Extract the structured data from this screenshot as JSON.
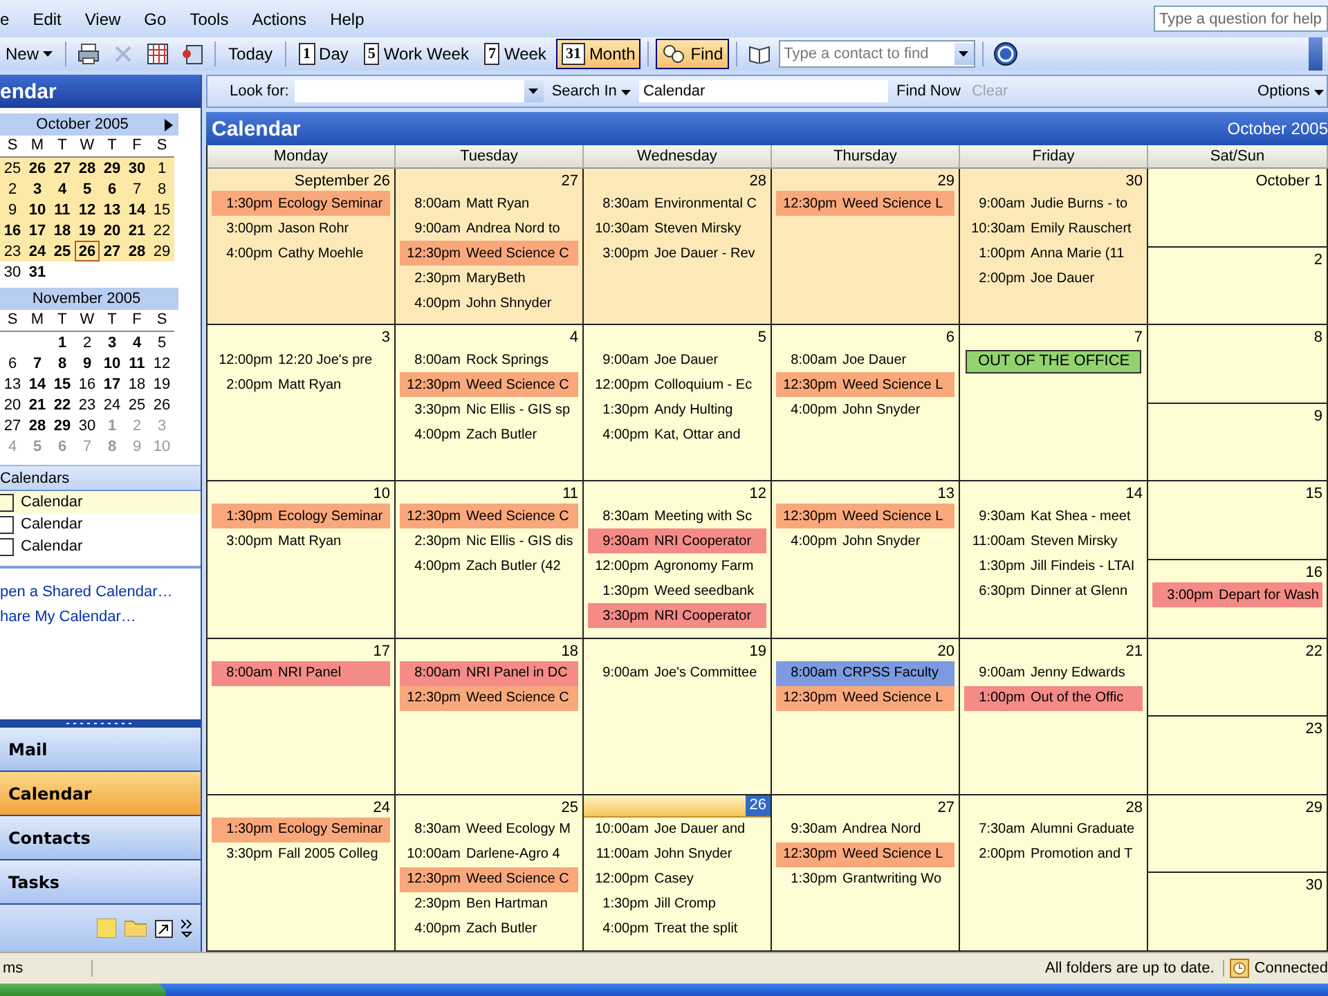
{
  "menu": [
    {
      "label": "e"
    },
    {
      "label": "Edit"
    },
    {
      "label": "View"
    },
    {
      "label": "Go"
    },
    {
      "label": "Tools"
    },
    {
      "label": "Actions"
    },
    {
      "label": "Help"
    }
  ],
  "help_box": {
    "placeholder": "Type a question for help"
  },
  "toolbar": [
    {
      "kind": "button",
      "label": "New",
      "dropdown": true,
      "selected": false
    },
    {
      "kind": "sep"
    },
    {
      "kind": "print",
      "disabled": false
    },
    {
      "kind": "delete",
      "disabled": true
    },
    {
      "kind": "grid",
      "disabled": false
    },
    {
      "kind": "address",
      "disabled": false
    },
    {
      "kind": "sep"
    },
    {
      "kind": "button",
      "label": "Today",
      "selected": false
    },
    {
      "kind": "sep"
    },
    {
      "kind": "button",
      "label": "Day",
      "badge": "1",
      "selected": false
    },
    {
      "kind": "button",
      "label": "Work Week",
      "badge": "5",
      "selected": false
    },
    {
      "kind": "button",
      "label": "Week",
      "badge": "7",
      "selected": false
    },
    {
      "kind": "button",
      "label": "Month",
      "badge": "31",
      "selected": true
    },
    {
      "kind": "sep"
    },
    {
      "kind": "find",
      "label": "Find",
      "selected": true
    },
    {
      "kind": "sep"
    },
    {
      "kind": "book",
      "disabled": false
    },
    {
      "kind": "field",
      "placeholder": "Type a contact to find"
    },
    {
      "kind": "sep"
    },
    {
      "kind": "help",
      "disabled": false
    }
  ],
  "pane_title": "endar",
  "mini_calendars": [
    {
      "title": "October 2005",
      "weekdays": [
        "S",
        "M",
        "T",
        "W",
        "T",
        "F",
        "S"
      ],
      "weeks": [
        {
          "in_view": true,
          "days": [
            {
              "day": "25",
              "bold": false,
              "dim": false,
              "selected": false
            },
            {
              "day": "26",
              "bold": true,
              "dim": false,
              "selected": false
            },
            {
              "day": "27",
              "bold": true,
              "dim": false,
              "selected": false
            },
            {
              "day": "28",
              "bold": true,
              "dim": false,
              "selected": false
            },
            {
              "day": "29",
              "bold": true,
              "dim": false,
              "selected": false
            },
            {
              "day": "30",
              "bold": true,
              "dim": false,
              "selected": false
            },
            {
              "day": "1",
              "bold": false,
              "dim": false,
              "selected": false
            }
          ]
        },
        {
          "in_view": true,
          "days": [
            {
              "day": "2",
              "bold": false,
              "dim": false,
              "selected": false
            },
            {
              "day": "3",
              "bold": true,
              "dim": false,
              "selected": false
            },
            {
              "day": "4",
              "bold": true,
              "dim": false,
              "selected": false
            },
            {
              "day": "5",
              "bold": true,
              "dim": false,
              "selected": false
            },
            {
              "day": "6",
              "bold": true,
              "dim": false,
              "selected": false
            },
            {
              "day": "7",
              "bold": false,
              "dim": false,
              "selected": false
            },
            {
              "day": "8",
              "bold": false,
              "dim": false,
              "selected": false
            }
          ]
        },
        {
          "in_view": true,
          "days": [
            {
              "day": "9",
              "bold": false,
              "dim": false,
              "selected": false
            },
            {
              "day": "10",
              "bold": true,
              "dim": false,
              "selected": false
            },
            {
              "day": "11",
              "bold": true,
              "dim": false,
              "selected": false
            },
            {
              "day": "12",
              "bold": true,
              "dim": false,
              "selected": false
            },
            {
              "day": "13",
              "bold": true,
              "dim": false,
              "selected": false
            },
            {
              "day": "14",
              "bold": true,
              "dim": false,
              "selected": false
            },
            {
              "day": "15",
              "bold": false,
              "dim": false,
              "selected": false
            }
          ]
        },
        {
          "in_view": true,
          "days": [
            {
              "day": "16",
              "bold": true,
              "dim": false,
              "selected": false
            },
            {
              "day": "17",
              "bold": true,
              "dim": false,
              "selected": false
            },
            {
              "day": "18",
              "bold": true,
              "dim": false,
              "selected": false
            },
            {
              "day": "19",
              "bold": true,
              "dim": false,
              "selected": false
            },
            {
              "day": "20",
              "bold": true,
              "dim": false,
              "selected": false
            },
            {
              "day": "21",
              "bold": true,
              "dim": false,
              "selected": false
            },
            {
              "day": "22",
              "bold": false,
              "dim": false,
              "selected": false
            }
          ]
        },
        {
          "in_view": true,
          "days": [
            {
              "day": "23",
              "bold": false,
              "dim": false,
              "selected": false
            },
            {
              "day": "24",
              "bold": true,
              "dim": false,
              "selected": false
            },
            {
              "day": "25",
              "bold": true,
              "dim": false,
              "selected": false
            },
            {
              "day": "26",
              "bold": true,
              "dim": false,
              "selected": true
            },
            {
              "day": "27",
              "bold": true,
              "dim": false,
              "selected": false
            },
            {
              "day": "28",
              "bold": true,
              "dim": false,
              "selected": false
            },
            {
              "day": "29",
              "bold": false,
              "dim": false,
              "selected": false
            }
          ]
        },
        {
          "in_view": false,
          "days": [
            {
              "day": "30",
              "bold": false,
              "dim": false,
              "selected": false
            },
            {
              "day": "31",
              "bold": true,
              "dim": false,
              "selected": false
            }
          ]
        }
      ]
    },
    {
      "title": "November 2005",
      "weekdays": [
        "S",
        "M",
        "T",
        "W",
        "T",
        "F",
        "S"
      ],
      "weeks": [
        {
          "in_view": false,
          "days": [
            {
              "day": "1",
              "bold": true,
              "dim": false,
              "selected": false
            },
            {
              "day": "2",
              "bold": false,
              "dim": false,
              "selected": false
            },
            {
              "day": "3",
              "bold": true,
              "dim": false,
              "selected": false
            },
            {
              "day": "4",
              "bold": true,
              "dim": false,
              "selected": false
            },
            {
              "day": "5",
              "bold": false,
              "dim": false,
              "selected": false
            }
          ]
        },
        {
          "in_view": false,
          "days": [
            {
              "day": "6",
              "bold": false,
              "dim": false,
              "selected": false
            },
            {
              "day": "7",
              "bold": true,
              "dim": false,
              "selected": false
            },
            {
              "day": "8",
              "bold": true,
              "dim": false,
              "selected": false
            },
            {
              "day": "9",
              "bold": true,
              "dim": false,
              "selected": false
            },
            {
              "day": "10",
              "bold": true,
              "dim": false,
              "selected": false
            },
            {
              "day": "11",
              "bold": true,
              "dim": false,
              "selected": false
            },
            {
              "day": "12",
              "bold": false,
              "dim": false,
              "selected": false
            }
          ]
        },
        {
          "in_view": false,
          "days": [
            {
              "day": "13",
              "bold": false,
              "dim": false,
              "selected": false
            },
            {
              "day": "14",
              "bold": true,
              "dim": false,
              "selected": false
            },
            {
              "day": "15",
              "bold": true,
              "dim": false,
              "selected": false
            },
            {
              "day": "16",
              "bold": false,
              "dim": false,
              "selected": false
            },
            {
              "day": "17",
              "bold": true,
              "dim": false,
              "selected": false
            },
            {
              "day": "18",
              "bold": false,
              "dim": false,
              "selected": false
            },
            {
              "day": "19",
              "bold": false,
              "dim": false,
              "selected": false
            }
          ]
        },
        {
          "in_view": false,
          "days": [
            {
              "day": "20",
              "bold": false,
              "dim": false,
              "selected": false
            },
            {
              "day": "21",
              "bold": true,
              "dim": false,
              "selected": false
            },
            {
              "day": "22",
              "bold": true,
              "dim": false,
              "selected": false
            },
            {
              "day": "23",
              "bold": false,
              "dim": false,
              "selected": false
            },
            {
              "day": "24",
              "bold": false,
              "dim": false,
              "selected": false
            },
            {
              "day": "25",
              "bold": false,
              "dim": false,
              "selected": false
            },
            {
              "day": "26",
              "bold": false,
              "dim": false,
              "selected": false
            }
          ]
        },
        {
          "in_view": false,
          "days": [
            {
              "day": "27",
              "bold": false,
              "dim": false,
              "selected": false
            },
            {
              "day": "28",
              "bold": true,
              "dim": false,
              "selected": false
            },
            {
              "day": "29",
              "bold": true,
              "dim": false,
              "selected": false
            },
            {
              "day": "30",
              "bold": false,
              "dim": false,
              "selected": false
            },
            {
              "day": "1",
              "bold": true,
              "dim": true,
              "selected": false
            },
            {
              "day": "2",
              "bold": false,
              "dim": true,
              "selected": false
            },
            {
              "day": "3",
              "bold": false,
              "dim": true,
              "selected": false
            }
          ]
        },
        {
          "in_view": false,
          "days": [
            {
              "day": "4",
              "bold": false,
              "dim": true,
              "selected": false
            },
            {
              "day": "5",
              "bold": true,
              "dim": true,
              "selected": false
            },
            {
              "day": "6",
              "bold": true,
              "dim": true,
              "selected": false
            },
            {
              "day": "7",
              "bold": false,
              "dim": true,
              "selected": false
            },
            {
              "day": "8",
              "bold": true,
              "dim": true,
              "selected": false
            },
            {
              "day": "9",
              "bold": false,
              "dim": true,
              "selected": false
            },
            {
              "day": "10",
              "bold": false,
              "dim": true,
              "selected": false
            }
          ]
        }
      ]
    }
  ],
  "calendars": {
    "title": "Calendars",
    "items": [
      {
        "label": "Calendar",
        "checked": false,
        "selected": true
      },
      {
        "label": "Calendar",
        "checked": false,
        "selected": false
      },
      {
        "label": "Calendar",
        "checked": false,
        "selected": false
      }
    ]
  },
  "links": [
    "pen a Shared Calendar…",
    "hare My Calendar…"
  ],
  "nav": [
    {
      "label": "Mail",
      "selected": false
    },
    {
      "label": "Calendar",
      "selected": true
    },
    {
      "label": "Contacts",
      "selected": false
    },
    {
      "label": "Tasks",
      "selected": false
    }
  ],
  "find_bar": {
    "look_for": "Look for:",
    "search_in": "Search In",
    "scope": "Calendar",
    "find_now": "Find Now",
    "clear": "Clear",
    "clear_disabled": true,
    "options": "Options"
  },
  "header": {
    "title": "Calendar",
    "month": "October 2005"
  },
  "columns": [
    "Monday",
    "Tuesday",
    "Wednesday",
    "Thursday",
    "Friday",
    "Sat/Sun"
  ],
  "weeks": [
    {
      "days": [
        {
          "date": "September 26",
          "other_month": true,
          "today": false,
          "events": [
            {
              "kind": "timed",
              "time": "1:30pm",
              "title": "Ecology Seminar",
              "color": "#f9a87c"
            },
            {
              "kind": "timed",
              "time": "3:00pm",
              "title": "Jason Rohr"
            },
            {
              "kind": "timed",
              "time": "4:00pm",
              "title": "Cathy Moehle"
            }
          ]
        },
        {
          "date": "27",
          "other_month": true,
          "today": false,
          "events": [
            {
              "kind": "timed",
              "time": "8:00am",
              "title": "Matt Ryan"
            },
            {
              "kind": "timed",
              "time": "9:00am",
              "title": "Andrea Nord to"
            },
            {
              "kind": "timed",
              "time": "12:30pm",
              "title": "Weed Science C",
              "color": "#f9a87c"
            },
            {
              "kind": "timed",
              "time": "2:30pm",
              "title": "MaryBeth"
            },
            {
              "kind": "timed",
              "time": "4:00pm",
              "title": "John Shnyder"
            }
          ]
        },
        {
          "date": "28",
          "other_month": true,
          "today": false,
          "events": [
            {
              "kind": "timed",
              "time": "8:30am",
              "title": "Environmental C"
            },
            {
              "kind": "timed",
              "time": "10:30am",
              "title": "Steven Mirsky"
            },
            {
              "kind": "timed",
              "time": "3:00pm",
              "title": "Joe Dauer - Rev"
            }
          ]
        },
        {
          "date": "29",
          "other_month": true,
          "today": false,
          "events": [
            {
              "kind": "timed",
              "time": "12:30pm",
              "title": "Weed Science L",
              "color": "#f9a87c"
            }
          ]
        },
        {
          "date": "30",
          "other_month": true,
          "today": false,
          "events": [
            {
              "kind": "timed",
              "time": "9:00am",
              "title": "Judie Burns - to"
            },
            {
              "kind": "timed",
              "time": "10:30am",
              "title": "Emily Rauschert"
            },
            {
              "kind": "timed",
              "time": "1:00pm",
              "title": "Anna Marie (11"
            },
            {
              "kind": "timed",
              "time": "2:00pm",
              "title": "Joe Dauer"
            }
          ]
        }
      ],
      "weekend": [
        {
          "date": "October 1",
          "other_month": false,
          "today": false
        },
        {
          "date": "2",
          "other_month": false,
          "today": false
        }
      ]
    },
    {
      "days": [
        {
          "date": "3",
          "other_month": false,
          "today": false,
          "events": [
            {
              "kind": "timed",
              "time": "12:00pm",
              "title": "12:20 Joe's pre"
            },
            {
              "kind": "timed",
              "time": "2:00pm",
              "title": "Matt Ryan"
            }
          ]
        },
        {
          "date": "4",
          "other_month": false,
          "today": false,
          "events": [
            {
              "kind": "timed",
              "time": "8:00am",
              "title": "Rock Springs"
            },
            {
              "kind": "timed",
              "time": "12:30pm",
              "title": "Weed Science C",
              "color": "#f9a87c"
            },
            {
              "kind": "timed",
              "time": "3:30pm",
              "title": "Nic Ellis - GIS sp"
            },
            {
              "kind": "timed",
              "time": "4:00pm",
              "title": "Zach Butler"
            }
          ]
        },
        {
          "date": "5",
          "other_month": false,
          "today": false,
          "events": [
            {
              "kind": "timed",
              "time": "9:00am",
              "title": "Joe Dauer"
            },
            {
              "kind": "timed",
              "time": "12:00pm",
              "title": "Colloquium - Ec"
            },
            {
              "kind": "timed",
              "time": "1:30pm",
              "title": "Andy Hulting"
            },
            {
              "kind": "timed",
              "time": "4:00pm",
              "title": "Kat, Ottar  and"
            }
          ]
        },
        {
          "date": "6",
          "other_month": false,
          "today": false,
          "events": [
            {
              "kind": "timed",
              "time": "8:00am",
              "title": "Joe Dauer"
            },
            {
              "kind": "timed",
              "time": "12:30pm",
              "title": "Weed Science L",
              "color": "#f9a87c"
            },
            {
              "kind": "timed",
              "time": "4:00pm",
              "title": "John Snyder"
            }
          ]
        },
        {
          "date": "7",
          "other_month": false,
          "today": false,
          "events": [
            {
              "kind": "allday",
              "title": "OUT OF THE OFFICE",
              "color": "#92d36e"
            }
          ]
        }
      ],
      "weekend": [
        {
          "date": "8",
          "other_month": false,
          "today": false
        },
        {
          "date": "9",
          "other_month": false,
          "today": false
        }
      ]
    },
    {
      "days": [
        {
          "date": "10",
          "other_month": false,
          "today": false,
          "events": [
            {
              "kind": "timed",
              "time": "1:30pm",
              "title": "Ecology Seminar",
              "color": "#f9a87c"
            },
            {
              "kind": "timed",
              "time": "3:00pm",
              "title": "Matt Ryan"
            }
          ]
        },
        {
          "date": "11",
          "other_month": false,
          "today": false,
          "events": [
            {
              "kind": "timed",
              "time": "12:30pm",
              "title": "Weed Science C",
              "color": "#f9a87c"
            },
            {
              "kind": "timed",
              "time": "2:30pm",
              "title": "Nic Ellis - GIS dis"
            },
            {
              "kind": "timed",
              "time": "4:00pm",
              "title": "Zach Butler (42"
            }
          ]
        },
        {
          "date": "12",
          "other_month": false,
          "today": false,
          "events": [
            {
              "kind": "timed",
              "time": "8:30am",
              "title": "Meeting with Sc"
            },
            {
              "kind": "timed",
              "time": "9:30am",
              "title": "NRI Cooperator",
              "color": "#f48b86"
            },
            {
              "kind": "timed",
              "time": "12:00pm",
              "title": "Agronomy Farm"
            },
            {
              "kind": "timed",
              "time": "1:30pm",
              "title": "Weed seedbank"
            },
            {
              "kind": "timed",
              "time": "3:30pm",
              "title": "NRI Cooperator",
              "color": "#f48b86"
            }
          ]
        },
        {
          "date": "13",
          "other_month": false,
          "today": false,
          "events": [
            {
              "kind": "timed",
              "time": "12:30pm",
              "title": "Weed Science L",
              "color": "#f9a87c"
            },
            {
              "kind": "timed",
              "time": "4:00pm",
              "title": "John Snyder"
            }
          ]
        },
        {
          "date": "14",
          "other_month": false,
          "today": false,
          "events": [
            {
              "kind": "timed",
              "time": "9:30am",
              "title": "Kat Shea - meet"
            },
            {
              "kind": "timed",
              "time": "11:00am",
              "title": "Steven Mirsky"
            },
            {
              "kind": "timed",
              "time": "1:30pm",
              "title": "Jill Findeis - LTAI"
            },
            {
              "kind": "timed",
              "time": "6:30pm",
              "title": "Dinner at Glenn"
            }
          ]
        }
      ],
      "weekend": [
        {
          "date": "15",
          "other_month": false,
          "today": false
        },
        {
          "date": "16",
          "other_month": false,
          "today": false,
          "events": [
            {
              "kind": "timed",
              "time": "3:00pm",
              "title": "Depart for Wash",
              "color": "#f48b86"
            }
          ]
        }
      ]
    },
    {
      "days": [
        {
          "date": "17",
          "other_month": false,
          "today": false,
          "events": [
            {
              "kind": "timed",
              "time": "8:00am",
              "title": "NRI Panel",
              "color": "#f48b86"
            }
          ]
        },
        {
          "date": "18",
          "other_month": false,
          "today": false,
          "events": [
            {
              "kind": "timed",
              "time": "8:00am",
              "title": "NRI Panel in DC",
              "color": "#f48b86"
            },
            {
              "kind": "timed",
              "time": "12:30pm",
              "title": "Weed Science C",
              "color": "#f9a87c"
            }
          ]
        },
        {
          "date": "19",
          "other_month": false,
          "today": false,
          "events": [
            {
              "kind": "timed",
              "time": "9:00am",
              "title": "Joe's Committee"
            }
          ]
        },
        {
          "date": "20",
          "other_month": false,
          "today": false,
          "events": [
            {
              "kind": "timed",
              "time": "8:00am",
              "title": "CRPSS Faculty",
              "color": "#7c9ae0"
            },
            {
              "kind": "timed",
              "time": "12:30pm",
              "title": "Weed Science L",
              "color": "#f9a87c"
            }
          ]
        },
        {
          "date": "21",
          "other_month": false,
          "today": false,
          "events": [
            {
              "kind": "timed",
              "time": "9:00am",
              "title": "Jenny Edwards"
            },
            {
              "kind": "timed",
              "time": "1:00pm",
              "title": "Out of the Offic",
              "color": "#f48b86"
            }
          ]
        }
      ],
      "weekend": [
        {
          "date": "22",
          "other_month": false,
          "today": false
        },
        {
          "date": "23",
          "other_month": false,
          "today": false
        }
      ]
    },
    {
      "days": [
        {
          "date": "24",
          "other_month": false,
          "today": false,
          "events": [
            {
              "kind": "timed",
              "time": "1:30pm",
              "title": "Ecology Seminar",
              "color": "#f9a87c"
            },
            {
              "kind": "timed",
              "time": "3:30pm",
              "title": "Fall 2005 Colleg"
            }
          ]
        },
        {
          "date": "25",
          "other_month": false,
          "today": false,
          "events": [
            {
              "kind": "timed",
              "time": "8:30am",
              "title": "Weed Ecology M"
            },
            {
              "kind": "timed",
              "time": "10:00am",
              "title": "Darlene-Agro 4"
            },
            {
              "kind": "timed",
              "time": "12:30pm",
              "title": "Weed Science C",
              "color": "#f9a87c"
            },
            {
              "kind": "timed",
              "time": "2:30pm",
              "title": "Ben Hartman"
            },
            {
              "kind": "timed",
              "time": "4:00pm",
              "title": "Zach Butler"
            }
          ]
        },
        {
          "date": "26",
          "other_month": false,
          "today": true,
          "events": [
            {
              "kind": "timed",
              "time": "10:00am",
              "title": "Joe Dauer and"
            },
            {
              "kind": "timed",
              "time": "11:00am",
              "title": "John Snyder"
            },
            {
              "kind": "timed",
              "time": "12:00pm",
              "title": "Casey"
            },
            {
              "kind": "timed",
              "time": "1:30pm",
              "title": "Jill Cromp"
            },
            {
              "kind": "timed",
              "time": "4:00pm",
              "title": "Treat the split"
            }
          ]
        },
        {
          "date": "27",
          "other_month": false,
          "today": false,
          "events": [
            {
              "kind": "timed",
              "time": "9:30am",
              "title": "Andrea Nord"
            },
            {
              "kind": "timed",
              "time": "12:30pm",
              "title": "Weed Science L",
              "color": "#f9a87c"
            },
            {
              "kind": "timed",
              "time": "1:30pm",
              "title": "Grantwriting Wo"
            }
          ]
        },
        {
          "date": "28",
          "other_month": false,
          "today": false,
          "events": [
            {
              "kind": "timed",
              "time": "7:30am",
              "title": "Alumni Graduate"
            },
            {
              "kind": "timed",
              "time": "2:00pm",
              "title": "Promotion and T"
            }
          ]
        }
      ],
      "weekend": [
        {
          "date": "29",
          "other_month": false,
          "today": false
        },
        {
          "date": "30",
          "other_month": false,
          "today": false
        }
      ]
    }
  ],
  "status_bar": {
    "left": "ms",
    "message": "All folders are up to date.",
    "connection": "Connected"
  }
}
